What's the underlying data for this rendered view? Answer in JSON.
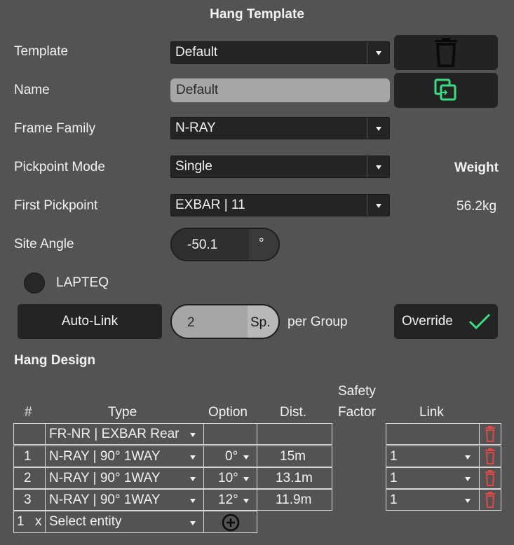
{
  "window": {
    "title": "Hang Template"
  },
  "fields": {
    "template": {
      "label": "Template",
      "value": "Default"
    },
    "name": {
      "label": "Name",
      "value": "Default"
    },
    "frame_family": {
      "label": "Frame Family",
      "value": "N-RAY"
    },
    "pickpoint_mode": {
      "label": "Pickpoint Mode",
      "value": "Single"
    },
    "first_pickpoint": {
      "label": "First Pickpoint",
      "value": "EXBAR | 11"
    },
    "site_angle": {
      "label": "Site Angle",
      "value": "-50.1",
      "unit": "°"
    }
  },
  "weight": {
    "label": "Weight",
    "value": "56.2kg"
  },
  "lapteq": {
    "label": "LAPTEQ"
  },
  "autolink": {
    "button_label": "Auto-Link",
    "value": "2",
    "unit": "Sp.",
    "suffix": "per Group",
    "override_label": "Override"
  },
  "hang_design": {
    "title": "Hang Design",
    "headers": {
      "index": "#",
      "type": "Type",
      "option": "Option",
      "dist": "Dist.",
      "safety_line1": "Safety",
      "safety_line2": "Factor",
      "link": "Link"
    },
    "top_row": {
      "type": "FR-NR | EXBAR Rear"
    },
    "rows": [
      {
        "index": "1",
        "type": "N-RAY | 90° 1WAY",
        "option": "0°",
        "dist": "15m",
        "link": "1"
      },
      {
        "index": "2",
        "type": "N-RAY | 90° 1WAY",
        "option": "10°",
        "dist": "13.1m",
        "link": "1"
      },
      {
        "index": "3",
        "type": "N-RAY | 90° 1WAY",
        "option": "12°",
        "dist": "11.9m",
        "link": "1"
      }
    ],
    "add_row": {
      "qty": "1",
      "x": "x",
      "placeholder": "Select entity"
    }
  },
  "colors": {
    "accent_green": "#3ddc84",
    "trash_red": "#e04848",
    "background": "#535353"
  }
}
